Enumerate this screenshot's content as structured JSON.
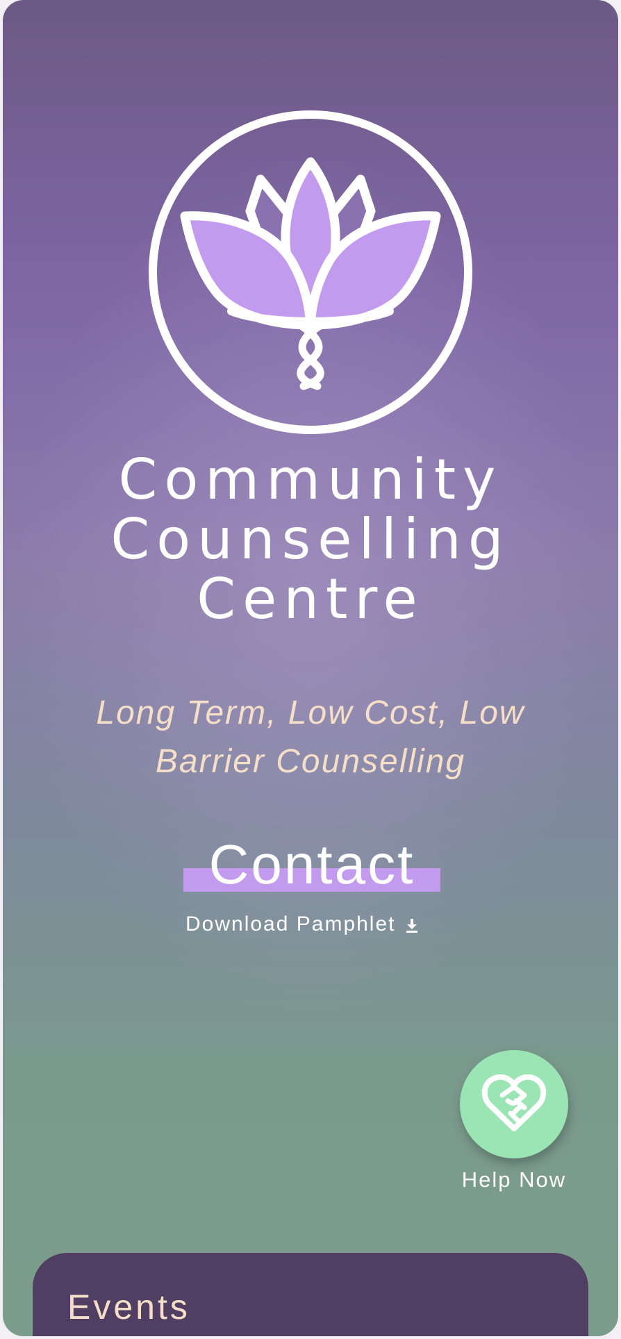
{
  "organization": {
    "title_lines": [
      "Community",
      "Counselling",
      "Centre"
    ]
  },
  "tagline": {
    "line1": "Long Term, Low Cost, Low",
    "line2": "Barrier Counselling"
  },
  "contact": {
    "label": "Contact"
  },
  "pamphlet": {
    "label": "Download Pamphlet",
    "icon": "download-icon"
  },
  "help": {
    "label": "Help Now",
    "icon": "heart-handshake-icon"
  },
  "events": {
    "title": "Events"
  },
  "colors": {
    "brand_purple": "#7f67a6",
    "accent_lavender": "#c39bee",
    "tagline_peach": "#f6dfc8",
    "help_mint": "#9be5b4",
    "events_card": "#513f63"
  }
}
